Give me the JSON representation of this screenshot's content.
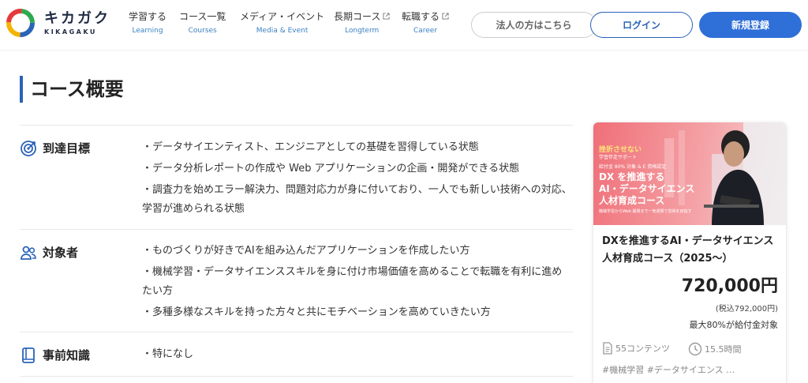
{
  "header": {
    "brand_jp": "キカガク",
    "brand_en": "KIKAGAKU",
    "nav": [
      {
        "jp": "学習する",
        "en": "Learning"
      },
      {
        "jp": "コース一覧",
        "en": "Courses"
      },
      {
        "jp": "メディア・イベント",
        "en": "Media & Event"
      },
      {
        "jp": "長期コース",
        "en": "Longterm"
      },
      {
        "jp": "転職する",
        "en": "Career"
      }
    ],
    "corp_label": "法人の方はこちら",
    "login_label": "ログイン",
    "signup_label": "新規登録"
  },
  "main": {
    "title": "コース概要",
    "sections": [
      {
        "label": "到達目標",
        "items": [
          "・データサイエンティスト、エンジニアとしての基礎を習得している状態",
          "・データ分析レポートの作成や Web アプリケーションの企画・開発ができる状態",
          "・調査力を始めエラー解決力、問題対応力が身に付いており、一人でも新しい技術への対応、学習が進められる状態"
        ]
      },
      {
        "label": "対象者",
        "items": [
          "・ものづくりが好きでAIを組み込んだアプリケーションを作成したい方",
          "・機械学習・データサイエンススキルを身に付け市場価値を高めることで転職を有利に進めたい方",
          "・多種多様なスキルを持った方々と共にモチベーションを高めていきたい方"
        ]
      },
      {
        "label": "事前知識",
        "items": [
          "・特になし"
        ]
      }
    ]
  },
  "card": {
    "banner": {
      "line1": "挫折させない",
      "line2": "学習伴走サポート",
      "line3": "給付金 80% 対象 & E 資格認定",
      "line4a": "DX を推進する",
      "line4b": "AI・データサイエンス",
      "line4c": "人材育成コース",
      "line5": "機械学習からWeb 開発まで一気通貫で習得を目指す"
    },
    "title": "DXを推進するAI・データサイエンス人材育成コース（2025〜）",
    "price": "720,000円",
    "tax": "(税込792,000円)",
    "subsidy": "最大80%が給付金対象",
    "contents": "55コンテンツ",
    "duration": "15.5時間",
    "tags": "#機械学習  #データサイエンス  …"
  },
  "colors": {
    "accent": "#2a63b8",
    "signup_bg": "#2f6fd8",
    "nav_sub": "#3b82c4",
    "banner": "#f06f78"
  }
}
